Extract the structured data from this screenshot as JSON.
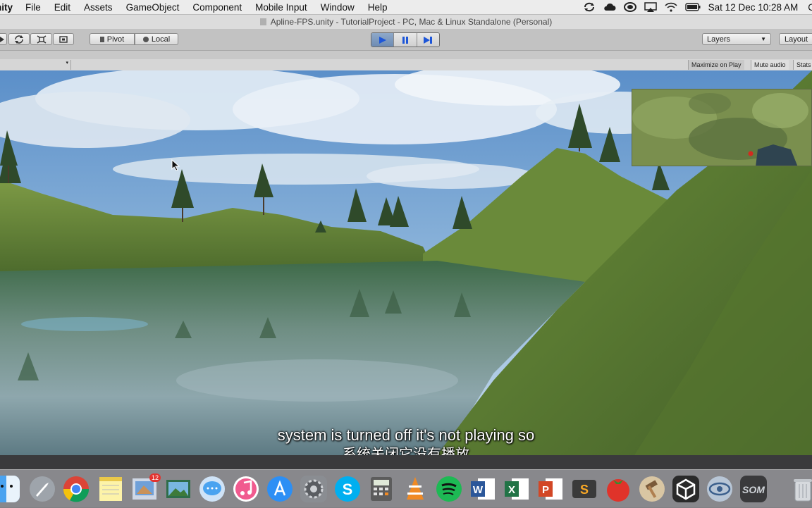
{
  "menubar": {
    "app_name": "nity",
    "items": [
      "File",
      "Edit",
      "Assets",
      "GameObject",
      "Component",
      "Mobile Input",
      "Window",
      "Help"
    ],
    "datetime": "Sat 12 Dec  10:28 AM",
    "right_edge": "C"
  },
  "window": {
    "title": "Apline-FPS.unity - TutorialProject - PC, Mac & Linux Standalone (Personal)"
  },
  "toolbar": {
    "pivot_label": "Pivot",
    "local_label": "Local",
    "layers_label": "Layers",
    "layout_label": "Layout"
  },
  "gameview": {
    "maximize_label": "Maximize on Play",
    "mute_label": "Mute audio",
    "stats_label": "Stats"
  },
  "subtitle": {
    "english": "system is turned off it's not playing so",
    "chinese": "系统关闭它没有播放"
  },
  "dock": {
    "photos_badge": "12",
    "apps": [
      "finder",
      "launchpad",
      "chrome",
      "notes",
      "preview",
      "photos",
      "messages",
      "itunes",
      "app-store",
      "system-preferences",
      "skype",
      "calculator",
      "vlc",
      "spotify",
      "word",
      "excel",
      "powerpoint",
      "sublime-text",
      "tomato-timer",
      "hammer",
      "unity",
      "network",
      "som",
      "trash"
    ]
  }
}
